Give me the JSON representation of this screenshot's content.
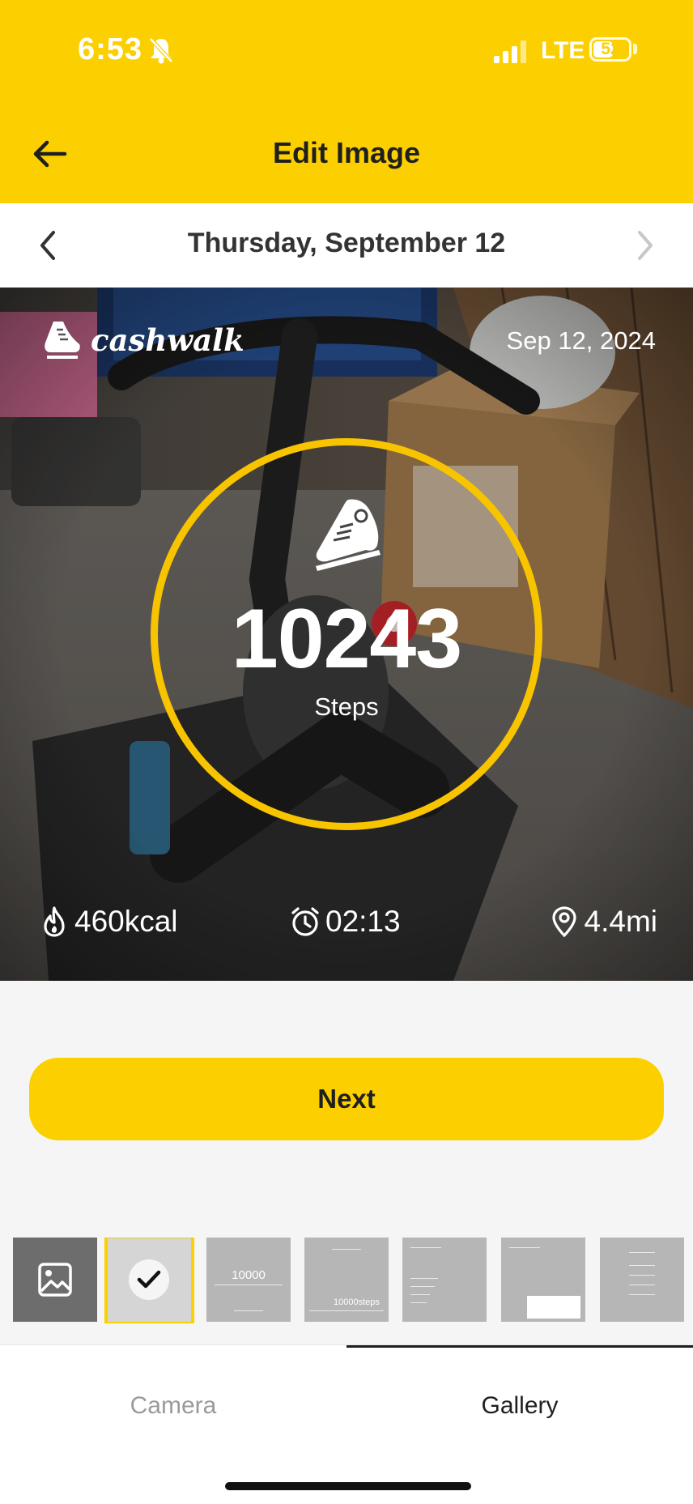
{
  "status_bar": {
    "time": "6:53",
    "network": "LTE",
    "battery": "52"
  },
  "header": {
    "title": "Edit Image"
  },
  "date_nav": {
    "date": "Thursday, September 12"
  },
  "photo_overlay": {
    "brand": "cashwalk",
    "date": "Sep 12, 2024",
    "steps_value": "10243",
    "steps_label": "Steps",
    "calories": "460kcal",
    "duration": "02:13",
    "distance": "4.4mi"
  },
  "actions": {
    "next_label": "Next"
  },
  "templates": {
    "t3_big": "10000",
    "t4_steps": "10000steps"
  },
  "tabs": {
    "camera": "Camera",
    "gallery": "Gallery"
  },
  "colors": {
    "accent": "#FCD000",
    "ring": "#F8C400"
  }
}
